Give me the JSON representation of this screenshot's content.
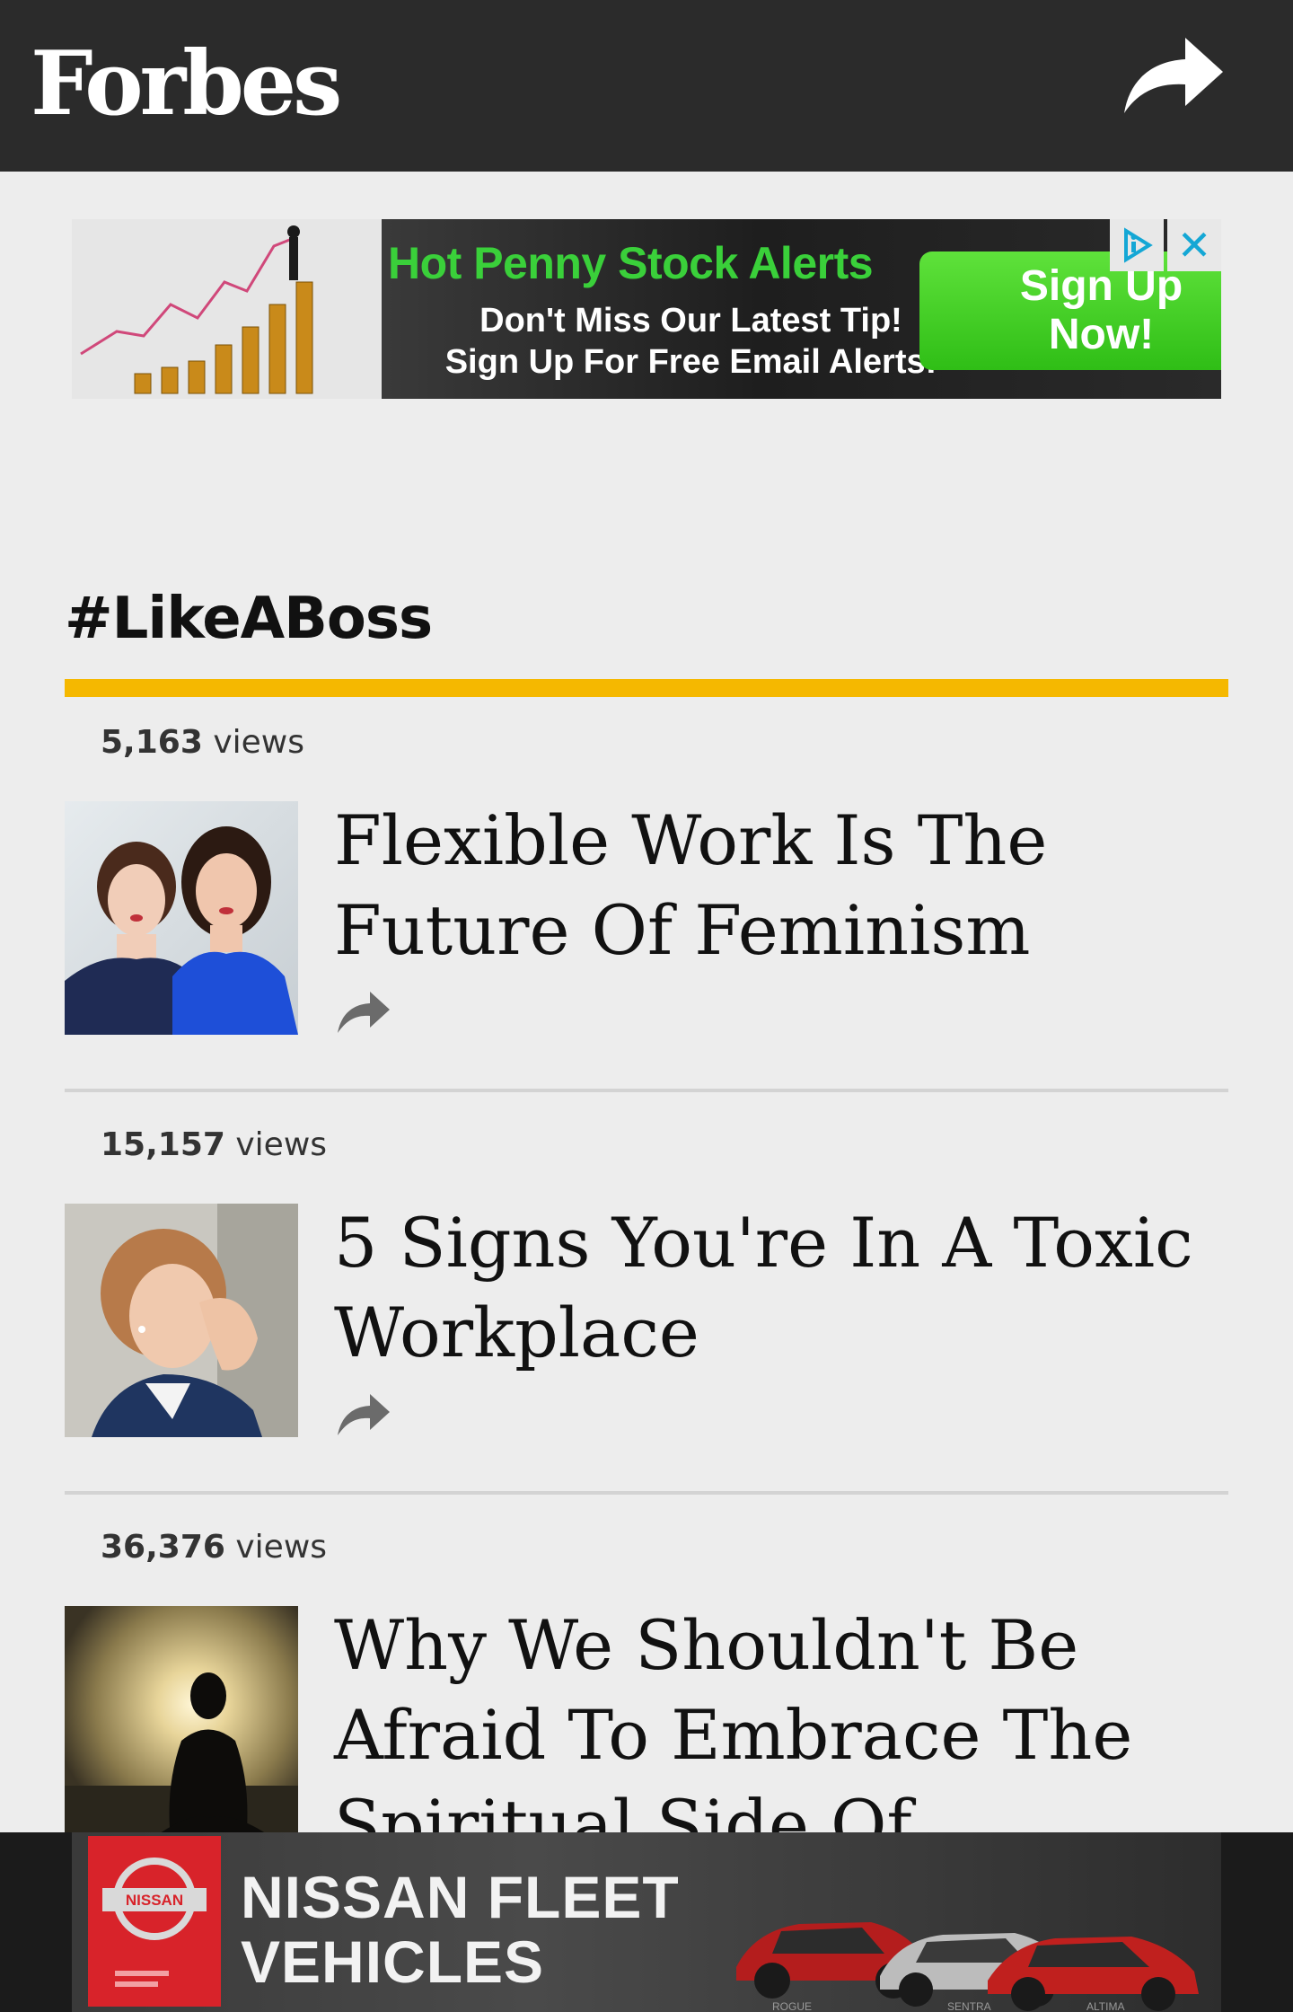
{
  "header": {
    "logo": "Forbes",
    "share_icon": "share-arrow-icon"
  },
  "top_ad": {
    "headline": "Hot Penny Stock Alerts",
    "line1": "Don't Miss Our Latest Tip!",
    "line2": "Sign Up For Free Email Alerts!",
    "cta_line1": "Sign Up",
    "cta_line2": "Now!",
    "adchoices_icon": "adchoices-icon",
    "close_icon": "close-icon",
    "close_glyph": "✕",
    "headline_color": "#3ad03a",
    "cta_color": "#3cc71f"
  },
  "section": {
    "title": "#LikeABoss",
    "accent_color": "#f5b800"
  },
  "articles": [
    {
      "views_count": "5,163",
      "views_label": "views",
      "headline": "Flexible Work Is The Future Of Feminism",
      "thumb_icon": "two-women-photo"
    },
    {
      "views_count": "15,157",
      "views_label": "views",
      "headline": "5 Signs You're In A Toxic Workplace",
      "thumb_icon": "stressed-woman-photo"
    },
    {
      "views_count": "36,376",
      "views_label": "views",
      "headline": "Why We Shouldn't Be Afraid To Embrace The Spiritual Side Of",
      "thumb_icon": "meditation-silhouette-photo"
    }
  ],
  "bottom_ad": {
    "brand_badge": "NISSAN",
    "title_line1": "NISSAN FLEET",
    "title_line2": "VEHICLES",
    "models": [
      "ROGUE",
      "SENTRA",
      "ALTIMA"
    ],
    "adchoices_icon": "adchoices-icon"
  }
}
